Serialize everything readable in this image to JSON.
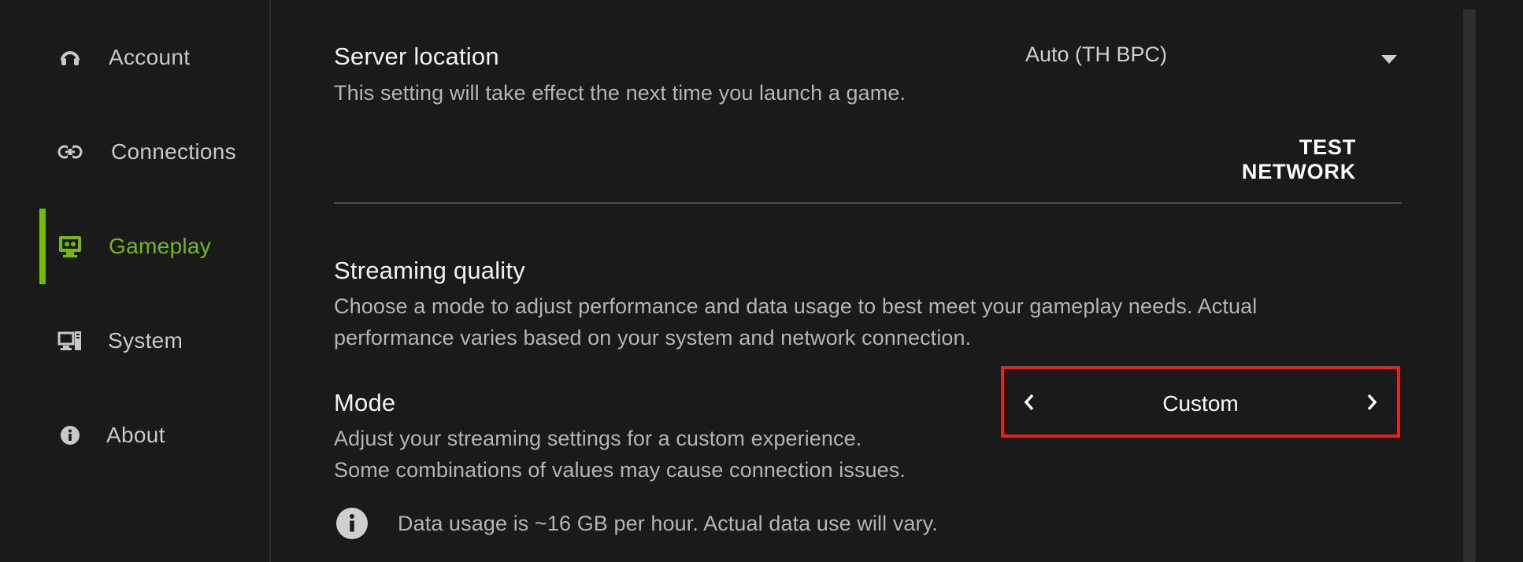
{
  "sidebar": {
    "items": [
      {
        "label": "Account",
        "icon": "headset-icon",
        "active": false
      },
      {
        "label": "Connections",
        "icon": "link-icon",
        "active": false
      },
      {
        "label": "Gameplay",
        "icon": "monitor-gamepad-icon",
        "active": true
      },
      {
        "label": "System",
        "icon": "desktop-tower-icon",
        "active": false
      },
      {
        "label": "About",
        "icon": "info-icon",
        "active": false
      }
    ]
  },
  "server_location": {
    "title": "Server location",
    "description": "This setting will take effect the next time you launch a game.",
    "selected": "Auto (TH BPC)",
    "test_button": "TEST NETWORK"
  },
  "streaming_quality": {
    "title": "Streaming quality",
    "description_line1": "Choose a mode to adjust performance and data usage to best meet your gameplay needs. Actual",
    "description_line2": "performance varies based on your system and network connection."
  },
  "mode": {
    "title": "Mode",
    "description_line1": "Adjust your streaming settings for a custom experience.",
    "description_line2": "Some combinations of values may cause connection issues.",
    "value": "Custom"
  },
  "data_usage": {
    "text": "Data usage is ~16 GB per hour. Actual data use will vary."
  },
  "colors": {
    "accent": "#76b900",
    "highlight_border": "#e0261b",
    "background": "#1a1a1a"
  }
}
